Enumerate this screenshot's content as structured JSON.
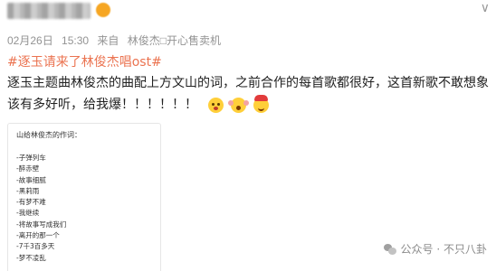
{
  "post": {
    "meta": {
      "date": "02月26日",
      "time": "15:30",
      "source_prefix": "来自",
      "device": "林俊杰□开心售卖机"
    },
    "topic": "#逐玉请来了林俊杰唱ost#",
    "body": {
      "text": "逐玉主题曲林俊杰的曲配上方文山的词，之前合作的每首歌都很好，这首新歌不敢想象该有多好听，给我爆！！！！！！"
    },
    "emojis": [
      "shocked-face-icon",
      "cheer-face-icon",
      "lucky-hat-face-icon"
    ],
    "card": {
      "title": "山给林俊杰的作词：",
      "items": [
        "-子弹列车",
        "-醉赤壁",
        "-故事细腻",
        "-黑莉雨",
        "-有梦不难",
        "-我继续",
        "-将故事写成我们",
        "-离开的那一个",
        "-7千3百多天",
        "-梦不凌乱"
      ]
    },
    "watermark": {
      "icon": "wechat-icon",
      "label": "公众号 · 不只八卦"
    },
    "colors": {
      "topic": "#eb7350",
      "meta": "#939393",
      "text": "#222222"
    }
  }
}
